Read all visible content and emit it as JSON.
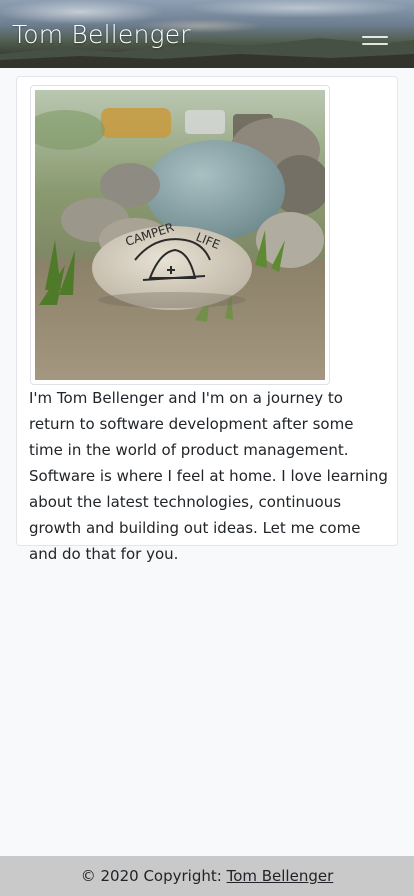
{
  "navbar": {
    "brand": "Tom Bellenger",
    "menu_icon": "hamburger-menu-icon"
  },
  "profile": {
    "photo_text": "CAMPER LIFE",
    "bio": "I'm Tom Bellenger and I'm on a journey to return to software development after some time in the world of product management. Software is where I feel at home. I love learning about the latest technologies, continuous growth and building out ideas. Let me come and do that for you."
  },
  "footer": {
    "copyright": "© 2020 Copyright:",
    "link_label": "Tom Bellenger"
  }
}
